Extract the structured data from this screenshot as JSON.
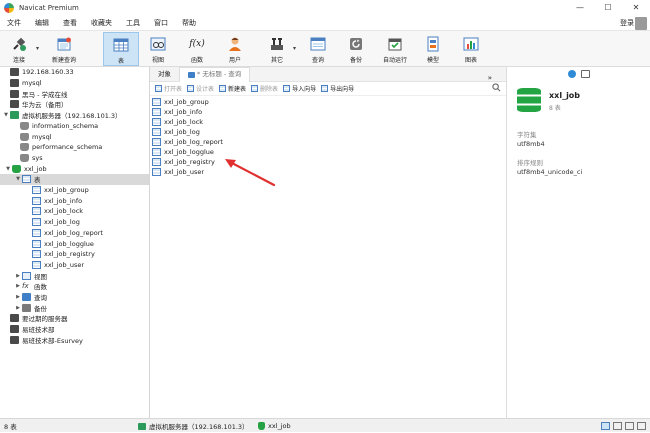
{
  "window": {
    "title": "Navicat Premium",
    "minimize": "—",
    "maximize": "☐",
    "close": "✕"
  },
  "menu": {
    "items": [
      "文件",
      "编辑",
      "查看",
      "收藏夹",
      "工具",
      "窗口",
      "帮助"
    ],
    "login": "登录"
  },
  "toolbar": {
    "items": [
      {
        "label": "连接",
        "icon": "connection-plug-icon"
      },
      {
        "label": "新建查询",
        "icon": "new-query-icon"
      },
      {
        "label": "表",
        "icon": "table-icon",
        "active": true
      },
      {
        "label": "视图",
        "icon": "view-icon"
      },
      {
        "label": "函数",
        "icon": "function-icon",
        "glyph": "f(x)"
      },
      {
        "label": "用户",
        "icon": "user-icon"
      },
      {
        "label": "其它",
        "icon": "tools-icon"
      },
      {
        "label": "查询",
        "icon": "query-icon"
      },
      {
        "label": "备份",
        "icon": "backup-icon"
      },
      {
        "label": "自动运行",
        "icon": "auto-run-icon"
      },
      {
        "label": "模型",
        "icon": "model-icon"
      },
      {
        "label": "图表",
        "icon": "chart-icon"
      }
    ]
  },
  "sidebar": {
    "rows": [
      {
        "label": "192.168.160.33",
        "icon": "server",
        "depth": 0
      },
      {
        "label": "mysql",
        "icon": "server",
        "depth": 0
      },
      {
        "label": "黑马 - 学成在线",
        "icon": "server",
        "depth": 0
      },
      {
        "label": "华为云（备用）",
        "icon": "server",
        "depth": 0
      },
      {
        "label": "虚拟机服务器（192.168.101.3）",
        "icon": "server-green",
        "depth": 0,
        "expanded": true
      },
      {
        "label": "information_schema",
        "icon": "db",
        "depth": 1
      },
      {
        "label": "mysql",
        "icon": "db",
        "depth": 1
      },
      {
        "label": "performance_schema",
        "icon": "db",
        "depth": 1
      },
      {
        "label": "sys",
        "icon": "db",
        "depth": 1
      },
      {
        "label": "xxl_job",
        "icon": "db-green",
        "depth": 1,
        "expanded": true
      },
      {
        "label": "表",
        "icon": "table",
        "depth": 2,
        "expanded": true,
        "selected": true
      },
      {
        "label": "xxl_job_group",
        "icon": "table",
        "depth": 3
      },
      {
        "label": "xxl_job_info",
        "icon": "table",
        "depth": 3
      },
      {
        "label": "xxl_job_lock",
        "icon": "table",
        "depth": 3
      },
      {
        "label": "xxl_job_log",
        "icon": "table",
        "depth": 3
      },
      {
        "label": "xxl_job_log_report",
        "icon": "table",
        "depth": 3
      },
      {
        "label": "xxl_job_logglue",
        "icon": "table",
        "depth": 3
      },
      {
        "label": "xxl_job_registry",
        "icon": "table",
        "depth": 3
      },
      {
        "label": "xxl_job_user",
        "icon": "table",
        "depth": 3
      },
      {
        "label": "视图",
        "icon": "view",
        "depth": 2,
        "collapsed": true
      },
      {
        "label": "函数",
        "icon": "func",
        "depth": 2,
        "collapsed": true
      },
      {
        "label": "查询",
        "icon": "query",
        "depth": 2,
        "collapsed": true
      },
      {
        "label": "备份",
        "icon": "backup",
        "depth": 2,
        "collapsed": true
      },
      {
        "label": "要过期的服务器",
        "icon": "server",
        "depth": 0
      },
      {
        "label": "易班技术部",
        "icon": "server",
        "depth": 0
      },
      {
        "label": "易班技术部-Esurvey",
        "icon": "server",
        "depth": 0
      }
    ]
  },
  "objects": {
    "tab_objects": "对象",
    "tab_query": "* 无标题 - 查询",
    "toolbar": {
      "open": "打开表",
      "design": "设计表",
      "new": "新建表",
      "delete": "删除表",
      "import": "导入向导",
      "export": "导出向导",
      "more": "»"
    },
    "tables": [
      "xxl_job_group",
      "xxl_job_info",
      "xxl_job_lock",
      "xxl_job_log",
      "xxl_job_log_report",
      "xxl_job_logglue",
      "xxl_job_registry",
      "xxl_job_user"
    ]
  },
  "details": {
    "name": "xxl_job",
    "count": "8 表",
    "charset_label": "字符集",
    "charset_value": "utf8mb4",
    "collation_label": "排序规则",
    "collation_value": "utf8mb4_unicode_ci"
  },
  "status": {
    "count": "8 表",
    "connection": "虚拟机服务器（192.168.101.3）",
    "database": "xxl_job"
  },
  "colors": {
    "accent": "#4a7fc1",
    "db_green": "#25a244",
    "arrow_red": "#e03030"
  }
}
